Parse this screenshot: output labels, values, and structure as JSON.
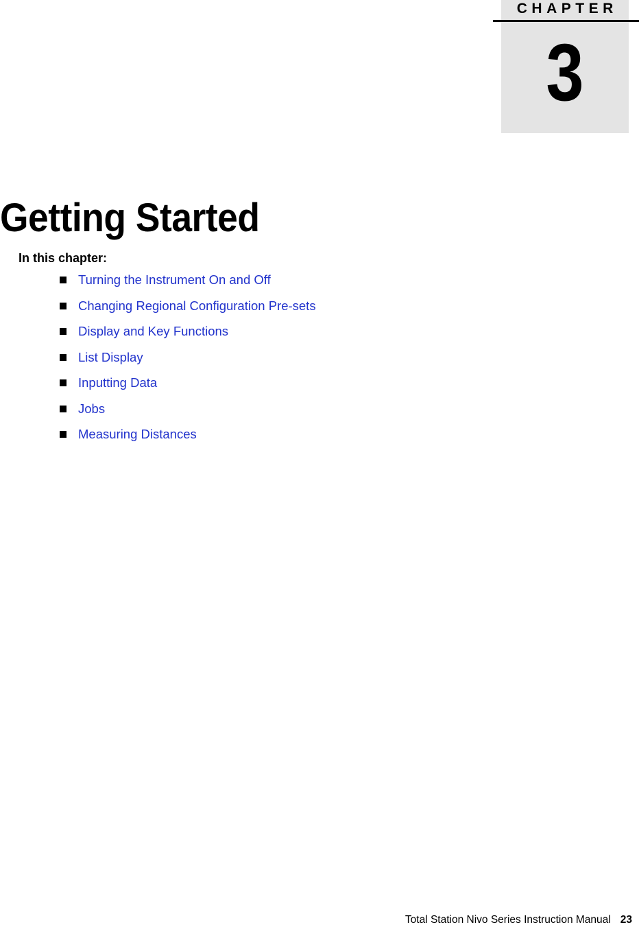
{
  "chapter_marker": {
    "label": "C H A P T E R",
    "label_plain": "CHAPTER",
    "number": "3",
    "block_color": "#e4e4e4",
    "rule_color": "#000000"
  },
  "page_title": "Getting Started",
  "section_heading": "In this chapter:",
  "toc": {
    "bullet_glyph": "square-bullet",
    "link_color": "#2233cc",
    "items": [
      {
        "label": "Turning the Instrument On and Off"
      },
      {
        "label": "Changing Regional Configuration Pre-sets"
      },
      {
        "label": "Display and Key Functions"
      },
      {
        "label": "List Display"
      },
      {
        "label": "Inputting Data"
      },
      {
        "label": "Jobs"
      },
      {
        "label": "Measuring Distances"
      }
    ]
  },
  "footer": {
    "document_title": "Total Station Nivo Series Instruction Manual",
    "page_number": "23"
  }
}
